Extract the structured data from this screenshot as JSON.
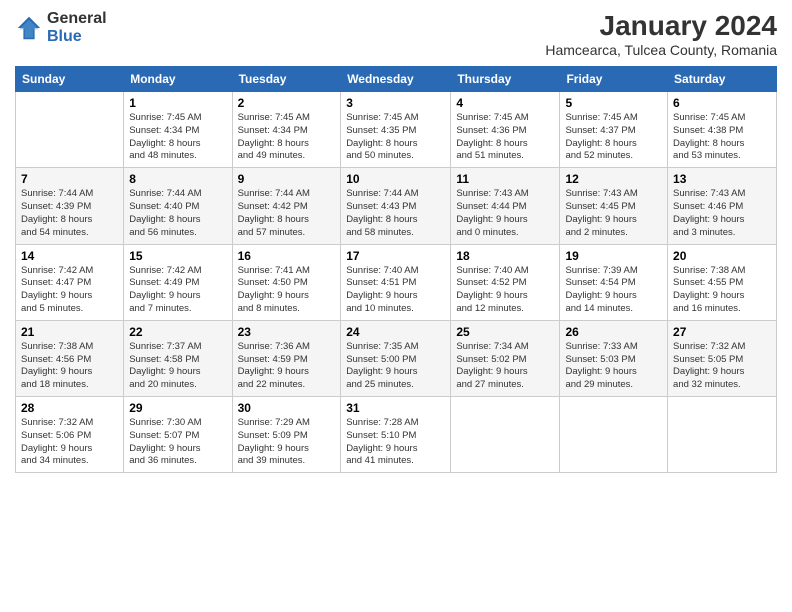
{
  "logo": {
    "general": "General",
    "blue": "Blue"
  },
  "title": "January 2024",
  "subtitle": "Hamcearca, Tulcea County, Romania",
  "weekdays": [
    "Sunday",
    "Monday",
    "Tuesday",
    "Wednesday",
    "Thursday",
    "Friday",
    "Saturday"
  ],
  "weeks": [
    [
      {
        "day": "",
        "info": ""
      },
      {
        "day": "1",
        "info": "Sunrise: 7:45 AM\nSunset: 4:34 PM\nDaylight: 8 hours\nand 48 minutes."
      },
      {
        "day": "2",
        "info": "Sunrise: 7:45 AM\nSunset: 4:34 PM\nDaylight: 8 hours\nand 49 minutes."
      },
      {
        "day": "3",
        "info": "Sunrise: 7:45 AM\nSunset: 4:35 PM\nDaylight: 8 hours\nand 50 minutes."
      },
      {
        "day": "4",
        "info": "Sunrise: 7:45 AM\nSunset: 4:36 PM\nDaylight: 8 hours\nand 51 minutes."
      },
      {
        "day": "5",
        "info": "Sunrise: 7:45 AM\nSunset: 4:37 PM\nDaylight: 8 hours\nand 52 minutes."
      },
      {
        "day": "6",
        "info": "Sunrise: 7:45 AM\nSunset: 4:38 PM\nDaylight: 8 hours\nand 53 minutes."
      }
    ],
    [
      {
        "day": "7",
        "info": "Sunrise: 7:44 AM\nSunset: 4:39 PM\nDaylight: 8 hours\nand 54 minutes."
      },
      {
        "day": "8",
        "info": "Sunrise: 7:44 AM\nSunset: 4:40 PM\nDaylight: 8 hours\nand 56 minutes."
      },
      {
        "day": "9",
        "info": "Sunrise: 7:44 AM\nSunset: 4:42 PM\nDaylight: 8 hours\nand 57 minutes."
      },
      {
        "day": "10",
        "info": "Sunrise: 7:44 AM\nSunset: 4:43 PM\nDaylight: 8 hours\nand 58 minutes."
      },
      {
        "day": "11",
        "info": "Sunrise: 7:43 AM\nSunset: 4:44 PM\nDaylight: 9 hours\nand 0 minutes."
      },
      {
        "day": "12",
        "info": "Sunrise: 7:43 AM\nSunset: 4:45 PM\nDaylight: 9 hours\nand 2 minutes."
      },
      {
        "day": "13",
        "info": "Sunrise: 7:43 AM\nSunset: 4:46 PM\nDaylight: 9 hours\nand 3 minutes."
      }
    ],
    [
      {
        "day": "14",
        "info": "Sunrise: 7:42 AM\nSunset: 4:47 PM\nDaylight: 9 hours\nand 5 minutes."
      },
      {
        "day": "15",
        "info": "Sunrise: 7:42 AM\nSunset: 4:49 PM\nDaylight: 9 hours\nand 7 minutes."
      },
      {
        "day": "16",
        "info": "Sunrise: 7:41 AM\nSunset: 4:50 PM\nDaylight: 9 hours\nand 8 minutes."
      },
      {
        "day": "17",
        "info": "Sunrise: 7:40 AM\nSunset: 4:51 PM\nDaylight: 9 hours\nand 10 minutes."
      },
      {
        "day": "18",
        "info": "Sunrise: 7:40 AM\nSunset: 4:52 PM\nDaylight: 9 hours\nand 12 minutes."
      },
      {
        "day": "19",
        "info": "Sunrise: 7:39 AM\nSunset: 4:54 PM\nDaylight: 9 hours\nand 14 minutes."
      },
      {
        "day": "20",
        "info": "Sunrise: 7:38 AM\nSunset: 4:55 PM\nDaylight: 9 hours\nand 16 minutes."
      }
    ],
    [
      {
        "day": "21",
        "info": "Sunrise: 7:38 AM\nSunset: 4:56 PM\nDaylight: 9 hours\nand 18 minutes."
      },
      {
        "day": "22",
        "info": "Sunrise: 7:37 AM\nSunset: 4:58 PM\nDaylight: 9 hours\nand 20 minutes."
      },
      {
        "day": "23",
        "info": "Sunrise: 7:36 AM\nSunset: 4:59 PM\nDaylight: 9 hours\nand 22 minutes."
      },
      {
        "day": "24",
        "info": "Sunrise: 7:35 AM\nSunset: 5:00 PM\nDaylight: 9 hours\nand 25 minutes."
      },
      {
        "day": "25",
        "info": "Sunrise: 7:34 AM\nSunset: 5:02 PM\nDaylight: 9 hours\nand 27 minutes."
      },
      {
        "day": "26",
        "info": "Sunrise: 7:33 AM\nSunset: 5:03 PM\nDaylight: 9 hours\nand 29 minutes."
      },
      {
        "day": "27",
        "info": "Sunrise: 7:32 AM\nSunset: 5:05 PM\nDaylight: 9 hours\nand 32 minutes."
      }
    ],
    [
      {
        "day": "28",
        "info": "Sunrise: 7:32 AM\nSunset: 5:06 PM\nDaylight: 9 hours\nand 34 minutes."
      },
      {
        "day": "29",
        "info": "Sunrise: 7:30 AM\nSunset: 5:07 PM\nDaylight: 9 hours\nand 36 minutes."
      },
      {
        "day": "30",
        "info": "Sunrise: 7:29 AM\nSunset: 5:09 PM\nDaylight: 9 hours\nand 39 minutes."
      },
      {
        "day": "31",
        "info": "Sunrise: 7:28 AM\nSunset: 5:10 PM\nDaylight: 9 hours\nand 41 minutes."
      },
      {
        "day": "",
        "info": ""
      },
      {
        "day": "",
        "info": ""
      },
      {
        "day": "",
        "info": ""
      }
    ]
  ]
}
